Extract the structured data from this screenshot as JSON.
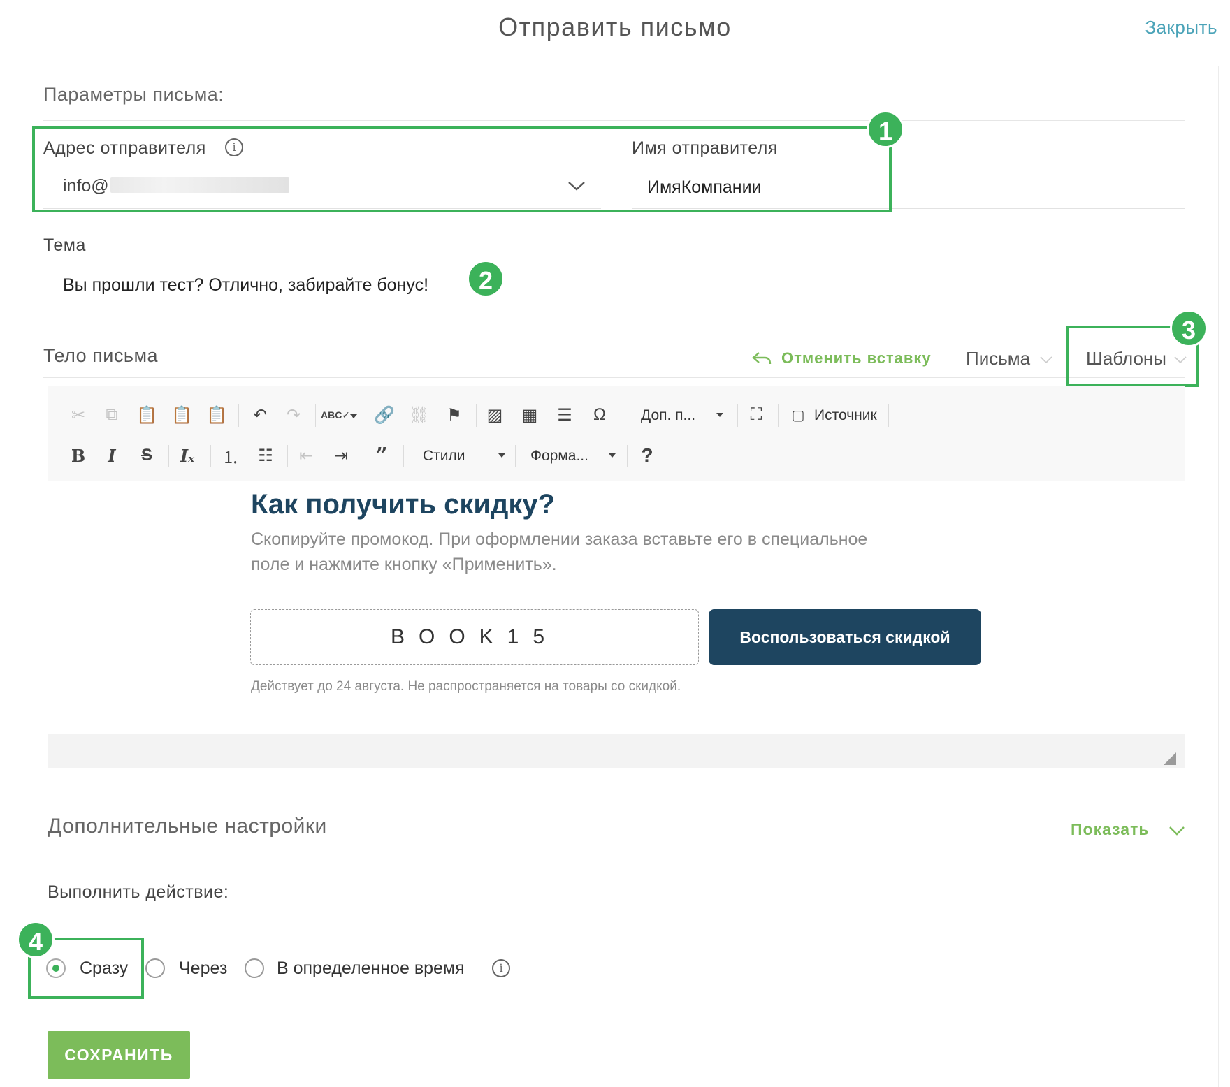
{
  "header": {
    "title": "Отправить письмо",
    "close_label": "Закрыть"
  },
  "params": {
    "section_label": "Параметры письма:",
    "sender_address_label": "Адрес отправителя",
    "sender_address_value": "info@",
    "sender_name_label": "Имя отправителя",
    "sender_name_value": "ИмяКомпании"
  },
  "subject": {
    "label": "Тема",
    "value": "Вы прошли тест? Отлично, забирайте бонус!"
  },
  "body": {
    "label": "Тело письма",
    "undo_insert": "Отменить вставку",
    "letters_dropdown": "Письма",
    "templates_dropdown": "Шаблоны"
  },
  "toolbar": {
    "more_label": "Доп. п...",
    "source_label": "Источник",
    "styles_label": "Стили",
    "format_label": "Форма...",
    "help_label": "?"
  },
  "email_content": {
    "heading": "Как получить скидку?",
    "paragraph_line1": "Скопируйте промокод. При оформлении заказа вставьте его в специальное",
    "paragraph_line2": "поле и нажмите кнопку «Применить».",
    "promo_code": "BOOK15",
    "promo_button": "Воспользоваться скидкой",
    "footnote": "Действует до 24 августа. Не распространяется на товары со скидкой."
  },
  "advanced": {
    "label": "Дополнительные настройки",
    "toggle_label": "Показать"
  },
  "action": {
    "label": "Выполнить действие:",
    "options": [
      "Сразу",
      "Через",
      "В определенное время"
    ],
    "selected": "Сразу"
  },
  "save_label": "СОХРАНИТЬ",
  "badges": [
    "1",
    "2",
    "3",
    "4"
  ],
  "colors": {
    "accent_green": "#3cb25a",
    "link_teal": "#4aa3b8",
    "button_navy": "#1e4560",
    "save_green": "#7cbc5a"
  }
}
